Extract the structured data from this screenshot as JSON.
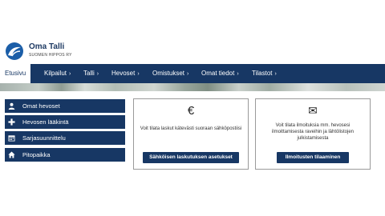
{
  "brand": {
    "title": "Oma Talli",
    "subtitle": "SUOMEN HIPPOS RY"
  },
  "nav": [
    {
      "label": "Etusivu",
      "active": true
    },
    {
      "label": "Kilpailut",
      "chevron": "›"
    },
    {
      "label": "Talli",
      "chevron": "›"
    },
    {
      "label": "Hevoset",
      "chevron": "›"
    },
    {
      "label": "Omistukset",
      "chevron": "›"
    },
    {
      "label": "Omat tiedot",
      "chevron": "›"
    },
    {
      "label": "Tilastot",
      "chevron": "›"
    }
  ],
  "sidebar": {
    "items": [
      {
        "label": "Omat hevoset",
        "icon": "user-icon"
      },
      {
        "label": "Hevosen lääkintä",
        "icon": "plus-icon"
      },
      {
        "label": "Sarjasuunnittelu",
        "icon": "calendar-icon"
      },
      {
        "label": "Pitopaikka",
        "icon": "home-icon"
      }
    ]
  },
  "cards": [
    {
      "icon": "euro-icon",
      "icon_glyph": "€",
      "text": "Voit tilata laskut kätevästi suoraan sähköpostiisi",
      "button": "Sähköisen laskutuksen asetukset"
    },
    {
      "icon": "envelope-icon",
      "icon_glyph": "✉",
      "text": "Voit tilata ilmoituksia mm. hevosesi ilmoittamisesta raveihin ja lähtölistojen julkistamisesta",
      "button": "Ilmoitusten tilaaminen"
    }
  ],
  "colors": {
    "primary": "#173764",
    "background": "#ffffff",
    "card_border": "#9a9a9a"
  }
}
